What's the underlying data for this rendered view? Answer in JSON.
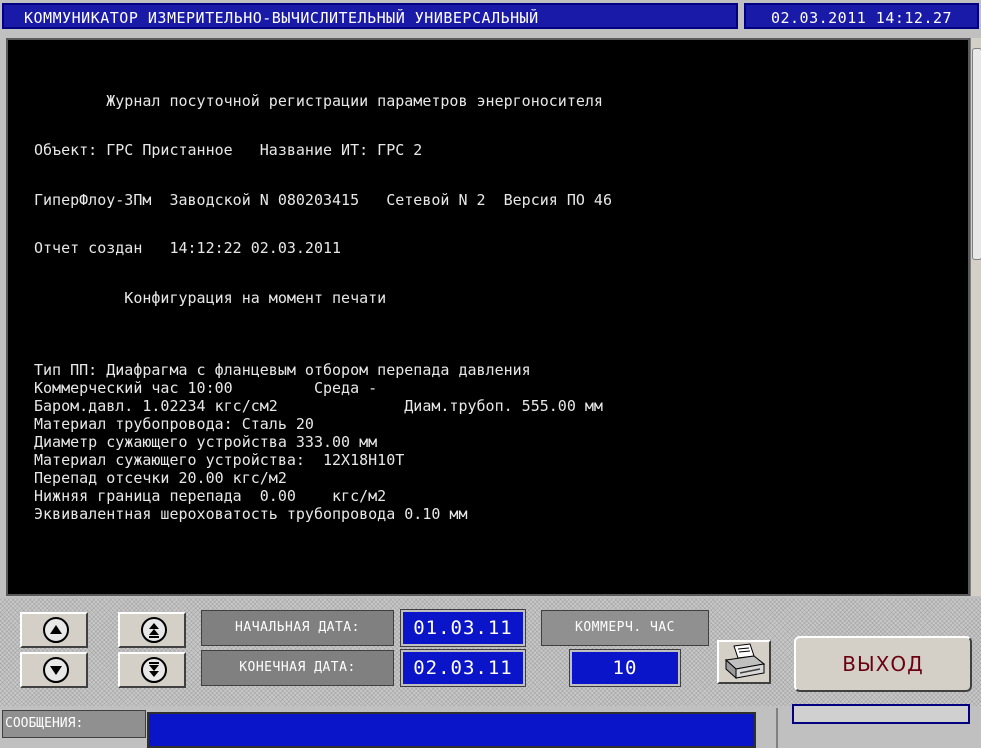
{
  "header": {
    "title": "КОММУНИКАТОР ИЗМЕРИТЕЛЬНО-ВЫЧИСЛИТЕЛЬНЫЙ УНИВЕРСАЛЬНЫЙ",
    "datetime": "02.03.2011 14:12.27"
  },
  "report": {
    "lines": [
      "        Журнал посуточной регистрации параметров энергоносителя",
      "Объект: ГРС Пристанное   Название ИТ: ГРС 2",
      "ГиперФлоу-3Пм  Заводской N 080203415   Сетевой N 2  Версия ПО 46",
      "Отчет создан   14:12:22 02.03.2011",
      "          Конфигурация на момент печати",
      "Тип ПП: Диафрагма с фланцевым отбором перепада давления",
      "Коммерческий час 10:00         Среда -",
      "Баром.давл. 1.02234 кгс/см2              Диам.трубоп. 555.00 мм",
      "Материал трубопровода: Сталь 20",
      "Диаметр сужающего устройства 333.00 мм",
      "Материал сужающего устройства:  12Х18Н10Т",
      "Перепад отсечки 20.00 кгс/м2",
      "Нижняя граница перепада  0.00    кгс/м2",
      "Эквивалентная шероховатость трубопровода 0.10 мм"
    ]
  },
  "controls": {
    "start_date_label": "НАЧАЛЬНАЯ ДАТА:",
    "start_date_value": "01.03.11",
    "end_date_label": "КОНЕЧНАЯ ДАТА:",
    "end_date_value": "02.03.11",
    "commercial_hour_label": "КОММЕРЧ. ЧАС",
    "commercial_hour_value": "10",
    "exit_label": "ВЫХОД"
  },
  "messages": {
    "label": "СООБЩЕНИЯ:",
    "text": ""
  },
  "icons": {
    "scroll_up": "arrow-up-icon",
    "page_up": "double-arrow-up-icon",
    "scroll_down": "arrow-down-icon",
    "page_down": "double-arrow-down-icon",
    "print": "printer-icon"
  },
  "colors": {
    "title_bg": "#1a1aa8",
    "value_bg": "#0a14c8",
    "report_bg": "#000000",
    "exit_text": "#6b0010"
  }
}
